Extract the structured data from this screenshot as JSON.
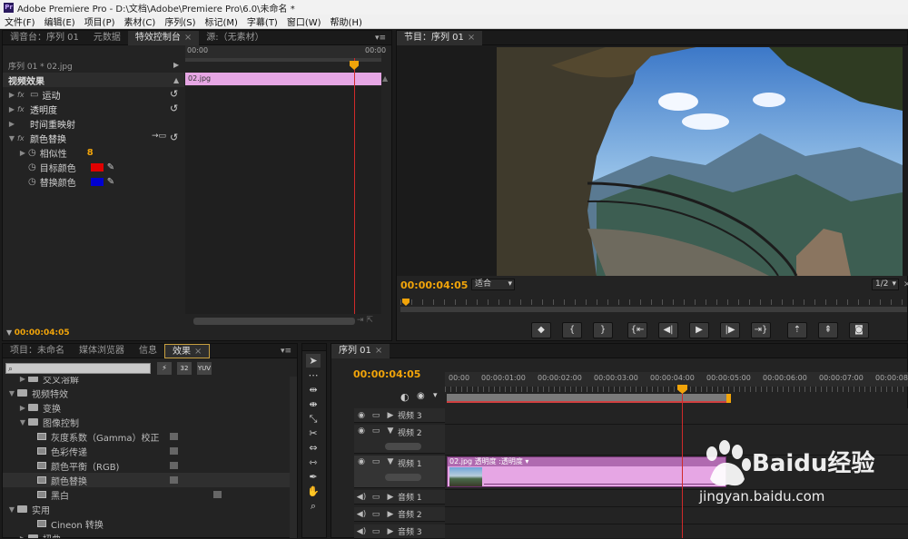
{
  "app": {
    "title": "Adobe Premiere Pro - D:\\文档\\Adobe\\Premiere Pro\\6.0\\未命名 *",
    "logo": "Pr"
  },
  "menu": [
    "文件(F)",
    "编辑(E)",
    "项目(P)",
    "素材(C)",
    "序列(S)",
    "标记(M)",
    "字幕(T)",
    "窗口(W)",
    "帮助(H)"
  ],
  "effect_controls": {
    "tabs": [
      "调音台：序列 01",
      "元数据",
      "特效控制台",
      "源:（无素材）"
    ],
    "active_tab": "特效控制台",
    "clip_path": "序列 01 * 02.jpg",
    "timecode_left": "00:00",
    "timecode_right": "00:00",
    "clip_name": "02.jpg",
    "section": "视频效果",
    "effects": [
      {
        "name": "运动",
        "fx": "fx"
      },
      {
        "name": "透明度",
        "fx": "fx"
      },
      {
        "name": "时间重映射",
        "fx": ""
      },
      {
        "name": "颜色替换",
        "fx": "fx"
      }
    ],
    "params": [
      {
        "name": "相似性",
        "value": "8"
      },
      {
        "name": "目标颜色",
        "color": "#e00000"
      },
      {
        "name": "替换颜色",
        "color": "#0000d0"
      }
    ],
    "current_time": "00:00:04:05"
  },
  "program": {
    "tab": "节目：序列 01",
    "timecode": "00:00:04:05",
    "fit": "适合",
    "ratio": "1/2"
  },
  "project": {
    "tabs": [
      "项目：未命名",
      "媒体浏览器",
      "信息",
      "效果"
    ],
    "active_tab": "效果",
    "tree": [
      {
        "label": "交叉溶解",
        "depth": 1,
        "type": "folder"
      },
      {
        "label": "视频特效",
        "depth": 0,
        "type": "folder"
      },
      {
        "label": "变换",
        "depth": 1,
        "type": "folder"
      },
      {
        "label": "图像控制",
        "depth": 1,
        "type": "folder"
      },
      {
        "label": "灰度系数（Gamma）校正",
        "depth": 2,
        "type": "effect"
      },
      {
        "label": "色彩传递",
        "depth": 2,
        "type": "effect"
      },
      {
        "label": "颜色平衡（RGB)",
        "depth": 2,
        "type": "effect"
      },
      {
        "label": "颜色替换",
        "depth": 2,
        "type": "effect"
      },
      {
        "label": "黑白",
        "depth": 2,
        "type": "effect"
      },
      {
        "label": "实用",
        "depth": 1,
        "type": "folder"
      },
      {
        "label": "Cineon 转换",
        "depth": 2,
        "type": "effect"
      },
      {
        "label": "扭曲",
        "depth": 1,
        "type": "folder"
      }
    ]
  },
  "timeline": {
    "tab": "序列 01",
    "timecode": "00:00:04:05",
    "ticks": [
      "00:00",
      "00:00:01:00",
      "00:00:02:00",
      "00:00:03:00",
      "00:00:04:00",
      "00:00:05:00",
      "00:00:06:00",
      "00:00:07:00",
      "00:00:08:00"
    ],
    "tracks": [
      "视频 3",
      "视频 2",
      "视频 1",
      "音频 1",
      "音频 2",
      "音频 3"
    ],
    "clip_label": "02.jpg  透明度 :透明度 ▾"
  },
  "watermark": {
    "brand": "Baidu经验",
    "url": "jingyan.baidu.com"
  },
  "colors": {
    "accent": "#f1a40a",
    "clip_pink": "#e6a6e4",
    "playhead": "#d02a2a"
  }
}
